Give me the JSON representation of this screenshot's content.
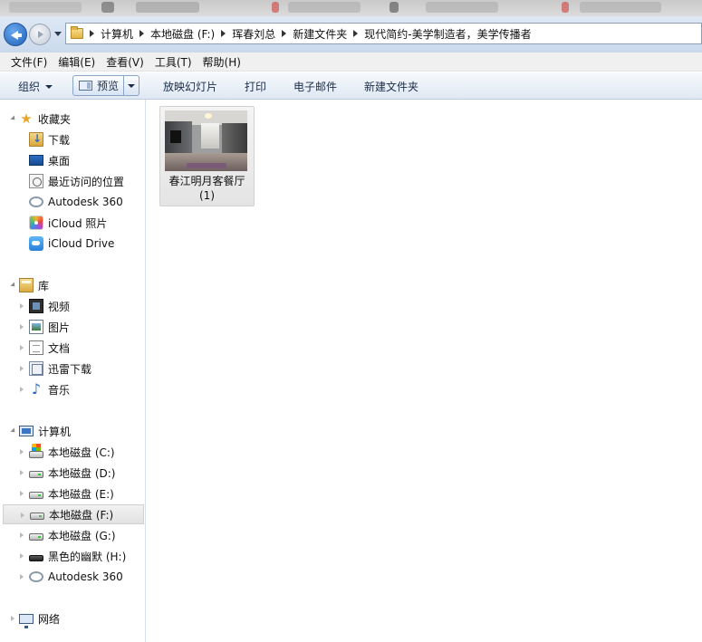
{
  "navigation": {
    "breadcrumbs": [
      "计算机",
      "本地磁盘 (F:)",
      "珲春刘总",
      "新建文件夹",
      "现代简约-美学制造者，美学传播者"
    ]
  },
  "menu": [
    "文件(F)",
    "编辑(E)",
    "查看(V)",
    "工具(T)",
    "帮助(H)"
  ],
  "toolbar": {
    "organize": "组织",
    "preview": "预览",
    "slideshow": "放映幻灯片",
    "print": "打印",
    "email": "电子邮件",
    "new_folder": "新建文件夹"
  },
  "sidebar": {
    "favorites": {
      "label": "收藏夹",
      "items": [
        "下载",
        "桌面",
        "最近访问的位置",
        "Autodesk 360",
        "iCloud 照片",
        "iCloud Drive"
      ]
    },
    "libraries": {
      "label": "库",
      "items": [
        "视频",
        "图片",
        "文档",
        "迅雷下载",
        "音乐"
      ]
    },
    "computer": {
      "label": "计算机",
      "items": [
        "本地磁盘 (C:)",
        "本地磁盘 (D:)",
        "本地磁盘 (E:)",
        "本地磁盘 (F:)",
        "本地磁盘 (G:)",
        "黑色的幽默 (H:)",
        "Autodesk 360"
      ],
      "selected": "本地磁盘 (F:)"
    },
    "network": {
      "label": "网络"
    }
  },
  "files": [
    {
      "name_line1": "春江明月客餐厅",
      "name_line2": "(1)",
      "icon": "image-thumbnail"
    }
  ],
  "colors": {
    "toolbar_gradient_top": "#f7fafd",
    "toolbar_gradient_bottom": "#dfe8f3",
    "nav_gradient_top": "#dfe9f5",
    "selection": "#e2e2e2"
  }
}
